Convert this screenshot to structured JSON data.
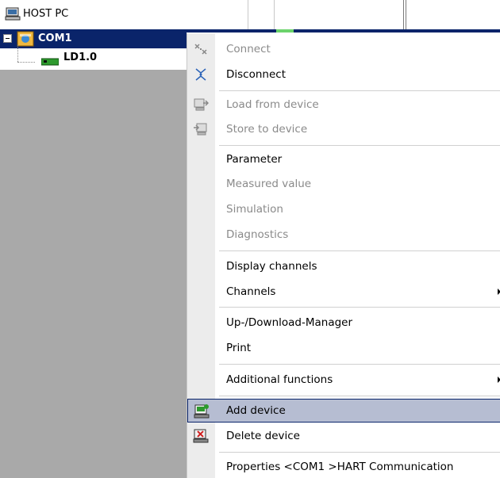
{
  "tree": {
    "host": {
      "label": "HOST PC",
      "icon": "computer-icon"
    },
    "com1": {
      "label": "COM1",
      "icon": "com-port-icon"
    },
    "ld1": {
      "label": "LD1.0",
      "icon": "device-icon"
    }
  },
  "menu": {
    "connect": "Connect",
    "disconnect": "Disconnect",
    "load_from_device": "Load from device",
    "store_to_device": "Store to device",
    "parameter": "Parameter",
    "measured_value": "Measured value",
    "simulation": "Simulation",
    "diagnostics": "Diagnostics",
    "display_channels": "Display channels",
    "channels": "Channels",
    "updownload_manager": "Up-/Download-Manager",
    "print": "Print",
    "additional_functions": "Additional functions",
    "add_device": "Add device",
    "delete_device": "Delete device",
    "properties": "Properties <COM1 >HART Communication"
  },
  "colors": {
    "selection": "#0a246a",
    "highlight": "#b6bdd2",
    "disabled_text": "#8a8a8a",
    "panel_gray": "#a9a9a9"
  }
}
